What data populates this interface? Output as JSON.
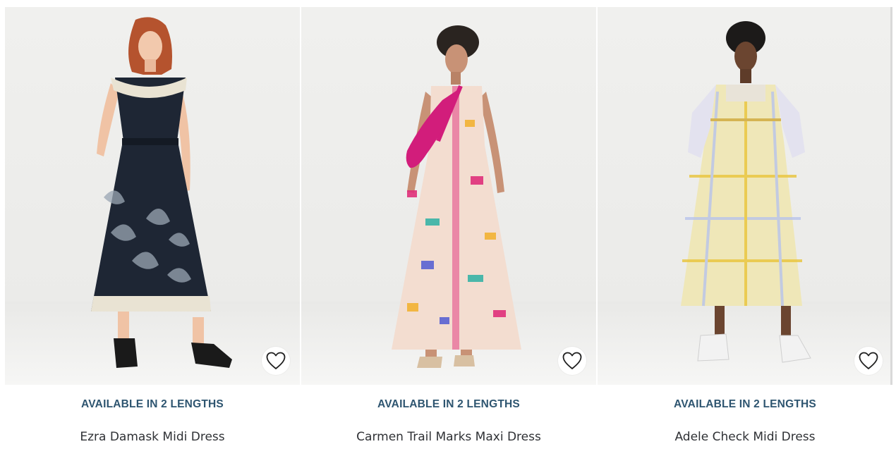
{
  "products": [
    {
      "lengths_label": "AVAILABLE IN 2 LENGTHS",
      "name": "Ezra Damask Midi Dress",
      "dress_color": "#1e2634",
      "accent_color": "#e9e3d3",
      "hair_color": "#b5532e",
      "skin_color": "#f2c9ad"
    },
    {
      "lengths_label": "AVAILABLE IN 2 LENGTHS",
      "name": "Carmen Trail Marks Maxi Dress",
      "dress_color": "#f3ddd0",
      "accent_color": "#e0307a",
      "hair_color": "#2a2420",
      "skin_color": "#c89276"
    },
    {
      "lengths_label": "AVAILABLE IN 2 LENGTHS",
      "name": "Adele Check Midi Dress",
      "dress_color": "#efe7b8",
      "accent_color": "#b8c4ec",
      "hair_color": "#1c1a19",
      "skin_color": "#6b4530"
    }
  ],
  "icons": {
    "wishlist": "heart-outline-icon"
  },
  "colors": {
    "lengths_text": "#2e5570",
    "name_text": "#2f3135"
  }
}
